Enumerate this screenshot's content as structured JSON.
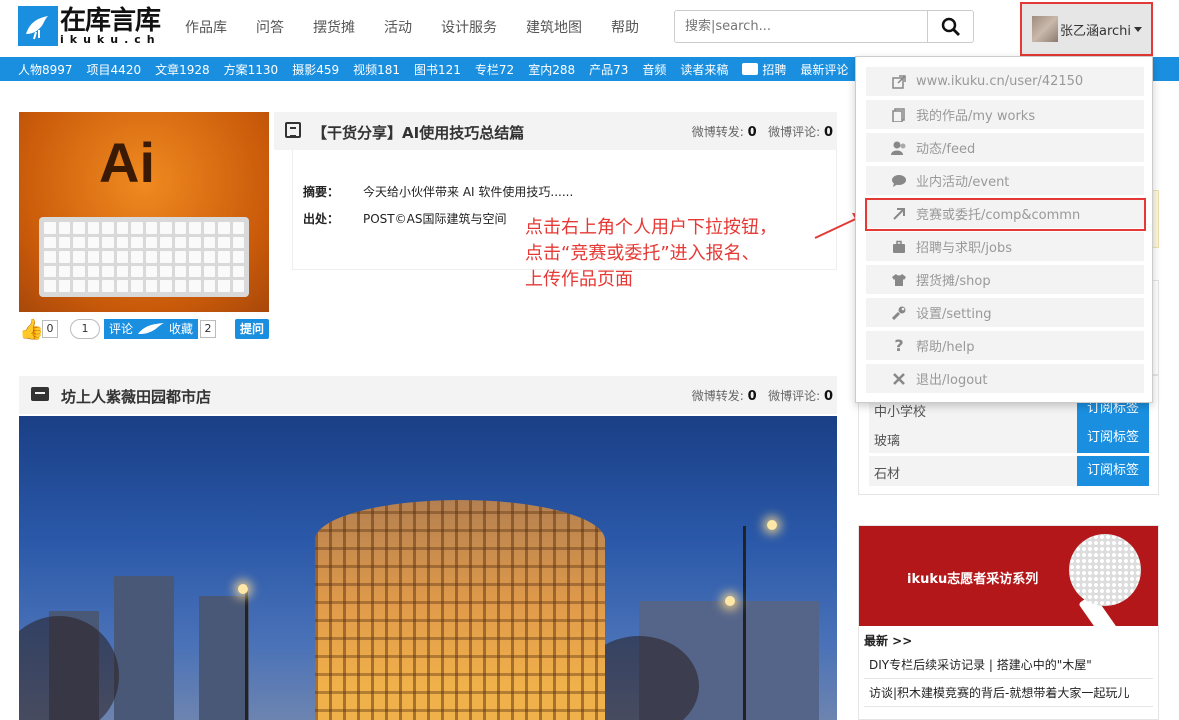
{
  "header": {
    "logo_cn": "在库言库",
    "logo_en": "ikuku.ch",
    "nav": [
      "作品库",
      "问答",
      "摆货摊",
      "活动",
      "设计服务",
      "建筑地图",
      "帮助"
    ],
    "search_placeholder": "搜索|search...",
    "username": "张乙涵archi"
  },
  "stats": [
    "人物8997",
    "项目4420",
    "文章1928",
    "方案1130",
    "摄影459",
    "视频181",
    "图书121",
    "专栏72",
    "室内288",
    "产品73",
    "音频",
    "读者来稿",
    "招聘",
    "最新评论"
  ],
  "post1": {
    "thumb_text": "Ai",
    "title": "【干货分享】AI使用技巧总结篇",
    "weibo_share_label": "微博转发:",
    "weibo_share_count": "0",
    "weibo_comment_label": "微博评论:",
    "weibo_comment_count": "0",
    "summary_label": "摘要：",
    "summary": "今天给小伙伴带来 AI 软件使用技巧......",
    "source_label": "出处：",
    "source": "POST©AS国际建筑与空间",
    "like_count": "0",
    "comment_count": "1",
    "comment_label": "评论",
    "collect_label": "收藏",
    "collect_count": "2",
    "report_label": "提问"
  },
  "post2": {
    "title": "坊上人紫薇田园都市店",
    "weibo_share_label": "微博转发:",
    "weibo_share_count": "0",
    "weibo_comment_label": "微博评论:",
    "weibo_comment_count": "0"
  },
  "sidebar": {
    "tags": [
      {
        "name": "中小学校",
        "button": "订阅标签"
      },
      {
        "name": "玻璃",
        "button": "订阅标签"
      },
      {
        "name": "石材",
        "button": "订阅标签"
      }
    ],
    "promo_title": "ikuku志愿者采访系列",
    "news_head": "最新 >>",
    "news": [
      "DIY专栏后续采访记录 | 搭建心中的\"木屋\"",
      "访谈|积木建模竞赛的背后-就想带着大家一起玩儿"
    ]
  },
  "dropdown": [
    {
      "icon": "external-link-icon",
      "label": "www.ikuku.cn/user/42150"
    },
    {
      "icon": "works-icon",
      "label": "我的作品/my works"
    },
    {
      "icon": "feed-icon",
      "label": "动态/feed"
    },
    {
      "icon": "chat-icon",
      "label": "业内活动/event"
    },
    {
      "icon": "arrow-icon",
      "label": "竞赛或委托/comp&commn"
    },
    {
      "icon": "briefcase-icon",
      "label": "招聘与求职/jobs"
    },
    {
      "icon": "shirt-icon",
      "label": "摆货摊/shop"
    },
    {
      "icon": "wrench-icon",
      "label": "设置/setting"
    },
    {
      "icon": "question-icon",
      "label": "帮助/help"
    },
    {
      "icon": "close-icon",
      "label": "退出/logout"
    }
  ],
  "annotation": {
    "line1": "点击右上角个人用户下拉按钮，",
    "line2": "点击“竞赛或委托”进入报名、",
    "line3": "上传作品页面",
    "color": "#e53935"
  },
  "colors": {
    "accent": "#1a8fe0",
    "highlight": "#e53935"
  }
}
